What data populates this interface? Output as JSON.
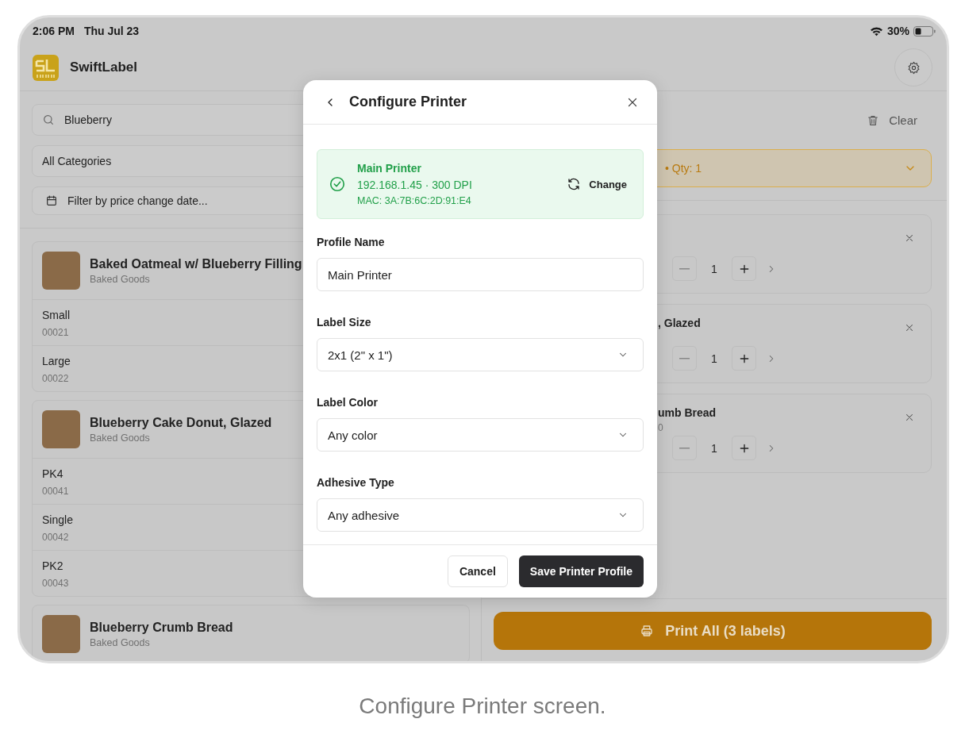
{
  "status_bar": {
    "time": "2:06 PM",
    "date": "Thu Jul 23",
    "battery": "30%"
  },
  "app": {
    "name": "SwiftLabel"
  },
  "filters": {
    "search": "Blueberry",
    "category": "All Categories",
    "date_placeholder": "Filter by price change date..."
  },
  "products": [
    {
      "name": "Baked Oatmeal w/ Blueberry Filling",
      "category": "Baked Goods",
      "variants": [
        {
          "name": "Small",
          "code": "00021"
        },
        {
          "name": "Large",
          "code": "00022"
        }
      ]
    },
    {
      "name": "Blueberry Cake Donut, Glazed",
      "category": "Baked Goods",
      "variants": [
        {
          "name": "PK4",
          "code": "00041"
        },
        {
          "name": "Single",
          "code": "00042"
        },
        {
          "name": "PK2",
          "code": "00043"
        }
      ]
    },
    {
      "name": "Blueberry Crumb Bread",
      "category": "Baked Goods"
    }
  ],
  "queue": {
    "clear": "Clear",
    "summary": "• Qty: 1",
    "items": [
      {
        "qty": "1"
      },
      {
        "title": ", Glazed",
        "qty": "1"
      },
      {
        "title": "umb Bread",
        "subtitle": "0",
        "qty": "1"
      }
    ],
    "print_button": "Print All (3 labels)"
  },
  "modal": {
    "title": "Configure Printer",
    "printer": {
      "name": "Main Printer",
      "address": "192.168.1.45 · 300 DPI",
      "mac": "MAC: 3A:7B:6C:2D:91:E4",
      "change": "Change"
    },
    "fields": [
      {
        "kind": "text",
        "label": "Profile Name",
        "value": "Main Printer"
      },
      {
        "kind": "select",
        "label": "Label Size",
        "value": "2x1 (2\" x 1\")"
      },
      {
        "kind": "select",
        "label": "Label Color",
        "value": "Any color"
      },
      {
        "kind": "select",
        "label": "Adhesive Type",
        "value": "Any adhesive"
      }
    ],
    "cancel": "Cancel",
    "save": "Save Printer Profile"
  },
  "caption": "Configure Printer screen."
}
